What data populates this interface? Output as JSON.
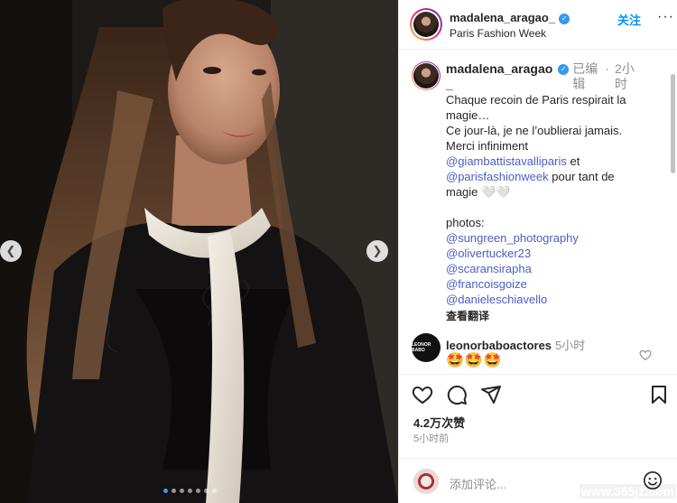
{
  "post": {
    "username": "madalena_aragao_",
    "location": "Paris Fashion Week",
    "follow_label": "关注",
    "more_label": "···",
    "verified_glyph": "✓"
  },
  "caption": {
    "username_line1": "madalena_aragao",
    "username_line2": "_",
    "edited_1": "已编",
    "edited_2": "辑",
    "time_1": "2小",
    "time_2": "时",
    "lines": [
      "Chaque recoin de Paris respirait la",
      "magie…",
      "Ce jour-là, je ne l’oublierai jamais.",
      "Merci infiniment"
    ],
    "mention_1": "@giambattistavalliparis",
    "after_mention_1": " et",
    "mention_2": "@parisfashionweek",
    "after_mention_2": " pour tant de",
    "line_end": "magie 🤍🤍",
    "photos_label": "photos:",
    "photo_credits": [
      "@sungreen_photography",
      "@olivertucker23",
      "@scaransiraphа",
      "@francoisgoize",
      "@danieleschiavello"
    ],
    "see_translation": "查看翻译"
  },
  "comment": {
    "username": "leonorbaboactores",
    "time": "5小时",
    "text": "🤩🤩🤩",
    "avatar_text": "LEONOR BABO"
  },
  "stats": {
    "likes": "4.2万次赞",
    "time_ago": "5小时前"
  },
  "add_comment": {
    "placeholder": "添加评论..."
  },
  "watermark": "www.365jz.com",
  "carousel": {
    "count": 7,
    "active": 0
  },
  "colors": {
    "link": "#0095f6",
    "mention": "#4a5ec7",
    "verified": "#3897f0",
    "muted": "#8e8e8e"
  },
  "icons": {
    "prev": "chevron-left-icon",
    "next": "chevron-right-icon",
    "like": "heart-icon",
    "comment": "comment-icon",
    "share": "send-icon",
    "save": "bookmark-icon",
    "emoji": "smiley-icon"
  }
}
